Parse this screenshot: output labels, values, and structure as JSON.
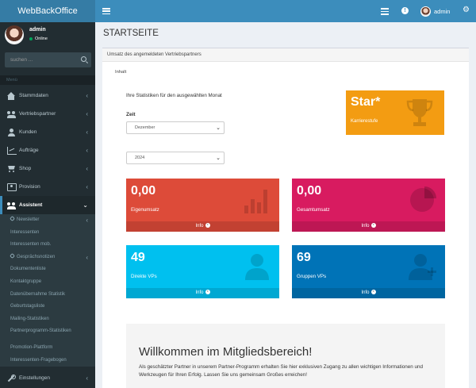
{
  "app": {
    "title": "WebBackOffice"
  },
  "header": {
    "username": "admin"
  },
  "sidebar": {
    "user": {
      "name": "admin",
      "status": "Online"
    },
    "search": {
      "placeholder": "suchen ..."
    },
    "menu_header": "Menü",
    "items": [
      {
        "label": "Stammdaten",
        "icon": "home-icon",
        "has_children": true
      },
      {
        "label": "Vertriebspartner",
        "icon": "users-icon",
        "has_children": true
      },
      {
        "label": "Kunden",
        "icon": "user-icon",
        "has_children": true
      },
      {
        "label": "Aufträge",
        "icon": "chart-icon",
        "has_children": true
      },
      {
        "label": "Shop",
        "icon": "cart-icon",
        "has_children": true
      },
      {
        "label": "Provision",
        "icon": "money-icon",
        "has_children": true
      },
      {
        "label": "Assistent",
        "icon": "users-icon",
        "active": true
      }
    ],
    "subitems": [
      {
        "label": "Newsletter",
        "has_children": true,
        "icon": "link-icon"
      },
      {
        "label": "Interessenten"
      },
      {
        "label": "Interessenten mob."
      },
      {
        "label": "Gesprächsnotizen",
        "has_children": true,
        "icon": "link-icon"
      },
      {
        "label": "Dokumentenliste"
      },
      {
        "label": "Kontaktgruppe"
      },
      {
        "label": "Datenübernahme Statistik"
      },
      {
        "label": "Geburtstagsliste"
      },
      {
        "label": "Mailing-Statistiken"
      },
      {
        "label": "Partnerprogramm-Statistiken"
      },
      {
        "label": "Promotion-Plattform"
      },
      {
        "label": "Interessenten-Fragebogen"
      }
    ],
    "settings": {
      "label": "Einstellungen",
      "icon": "wrench-icon"
    }
  },
  "page": {
    "title": "STARTSEITE",
    "box_title": "Umsatz des angemeldeten Vertriebspartners",
    "tab": "Inhalt",
    "stats_text": "Ihre Statistiken für den ausgewählten Monat",
    "zeit_label": "Zeit",
    "month_select": "Dezember",
    "year_select": "2024",
    "star": {
      "title": "Star*",
      "subtitle": "Karrierestufe"
    },
    "boxes": {
      "eigenumsatz": {
        "value": "0,00",
        "label": "Eigenumsatz",
        "footer": "Info",
        "color": "#dd4b39"
      },
      "gesamtumsatz": {
        "value": "0,00",
        "label": "Gesamtumsatz",
        "footer": "Info",
        "color": "#d81b60"
      },
      "direkte": {
        "value": "49",
        "label": "Direkte VPs",
        "footer": "Info",
        "color": "#00c0ef"
      },
      "gruppen": {
        "value": "69",
        "label": "Gruppen VPs",
        "footer": "Info",
        "color": "#0073b7"
      }
    },
    "welcome": {
      "title": "Willkommen im Mitgliedsbereich!",
      "text": "Als geschätzter Partner in unserem Partner-Programm erhalten Sie hier exklusiven Zugang zu allen wichtigen Informationen und Werkzeugen für Ihren Erfolg. Lassen Sie uns gemeinsam Großes erreichen!"
    }
  },
  "colors": {
    "header": "#3c8dbc",
    "logo": "#357ca5",
    "sidebar": "#222d32",
    "star": "#f39c12"
  }
}
